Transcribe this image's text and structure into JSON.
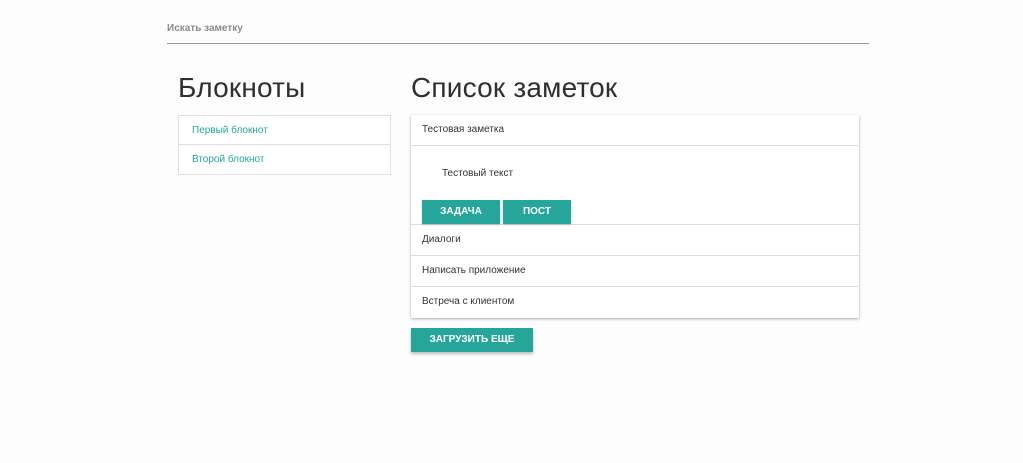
{
  "search": {
    "placeholder": "Искать заметку",
    "value": ""
  },
  "sidebar": {
    "title": "Блокноты",
    "items": [
      {
        "label": "Первый блокнот"
      },
      {
        "label": "Второй блокнот"
      }
    ]
  },
  "notes": {
    "title": "Список заметок",
    "expanded": {
      "title": "Тестовая заметка",
      "text": "Тестовый текст",
      "tags": [
        "ЗАДАЧА",
        "ПОСТ"
      ]
    },
    "items": [
      {
        "title": "Диалоги"
      },
      {
        "title": "Написать приложение"
      },
      {
        "title": "Встреча с клиентом"
      }
    ],
    "load_more_label": "ЗАГРУЗИТЬ ЕЩЕ"
  },
  "colors": {
    "accent": "#26a69a"
  }
}
